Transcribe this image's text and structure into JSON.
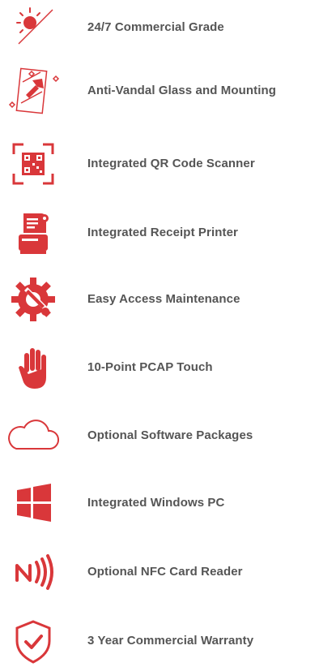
{
  "accent_color": "#d9373a",
  "text_color": "#555555",
  "features": [
    {
      "label": "24/7 Commercial Grade",
      "icon": "sun-moon-icon"
    },
    {
      "label": "Anti-Vandal Glass and Mounting",
      "icon": "shield-hammer-glass-icon"
    },
    {
      "label": "Integrated QR Code Scanner",
      "icon": "qr-scan-icon"
    },
    {
      "label": "Integrated Receipt Printer",
      "icon": "receipt-printer-icon"
    },
    {
      "label": "Easy Access Maintenance",
      "icon": "gear-wrench-icon"
    },
    {
      "label": "10-Point PCAP Touch",
      "icon": "hand-icon"
    },
    {
      "label": "Optional Software Packages",
      "icon": "cloud-icon"
    },
    {
      "label": "Integrated Windows PC",
      "icon": "windows-logo-icon"
    },
    {
      "label": "Optional NFC Card Reader",
      "icon": "nfc-icon"
    },
    {
      "label": "3 Year Commercial Warranty",
      "icon": "shield-check-icon"
    }
  ]
}
